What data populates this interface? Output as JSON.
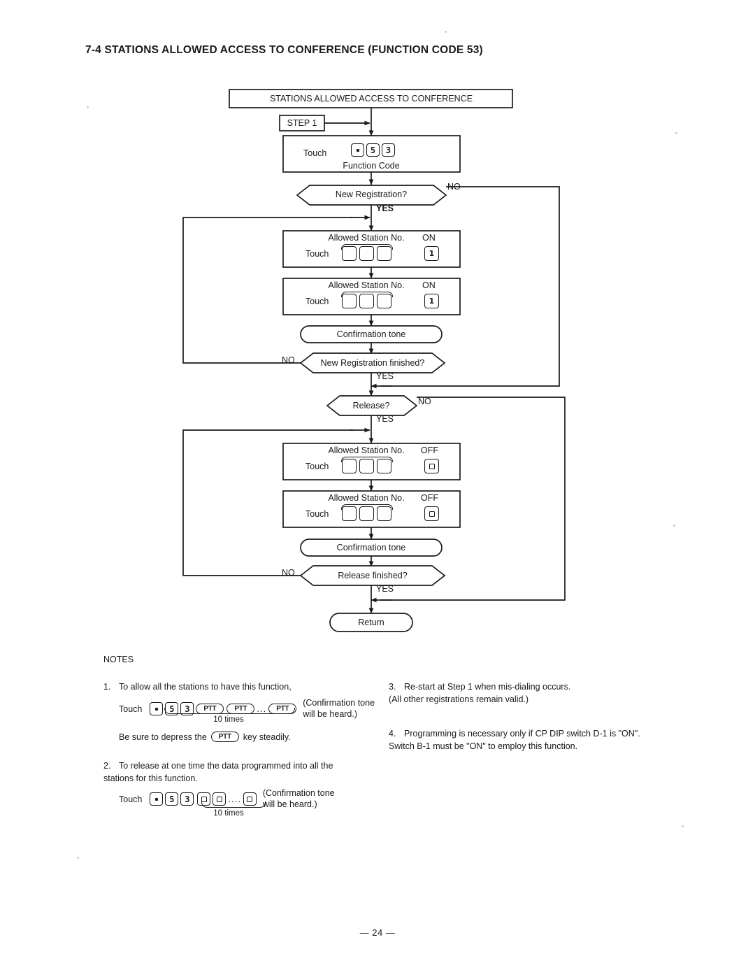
{
  "document": {
    "heading": "7-4 STATIONS ALLOWED ACCESS TO CONFERENCE (FUNCTION CODE 53)",
    "page_number": "— 24 —"
  },
  "flowchart": {
    "title_box": "STATIONS ALLOWED ACCESS TO CONFERENCE",
    "step_tag": "STEP 1",
    "function_code_box": {
      "touch_label": "Touch",
      "caption": "Function Code",
      "keys": [
        "dot",
        "5",
        "3"
      ]
    },
    "decisions": {
      "new_registration": "New Registration?",
      "new_registration_finished": "New Registration finished?",
      "release": "Release?",
      "release_finished": "Release finished?"
    },
    "branch_labels": {
      "yes": "YES",
      "no": "NO"
    },
    "station_on_box": {
      "title": "Allowed Station No.",
      "touch_label": "Touch",
      "state_label": "ON",
      "state_key": "1",
      "station_keys": [
        "",
        "",
        ""
      ]
    },
    "station_off_box": {
      "title": "Allowed Station No.",
      "touch_label": "Touch",
      "state_label": "OFF",
      "state_key": "0",
      "station_keys": [
        "",
        "",
        ""
      ]
    },
    "confirmation_tone": "Confirmation tone",
    "return_terminal": "Return"
  },
  "notes": {
    "label": "NOTES",
    "items": [
      {
        "number": "1.",
        "text": "To allow all the stations to have this function,",
        "touch_label": "Touch",
        "keys": [
          "dot",
          "5",
          "3"
        ],
        "ptt_label": "PTT",
        "ellipsis": "...",
        "repeat_label": "10 times",
        "paren_text": "(Confirmation tone\nwill be heard.)",
        "footer_before": "Be sure to depress the",
        "footer_after": "key steadily."
      },
      {
        "number": "2.",
        "text": "To release at one time the data programmed into all the\nstations for this function.",
        "touch_label": "Touch",
        "keys": [
          "dot",
          "5",
          "3"
        ],
        "zero_key": "0",
        "ellipsis": "....",
        "repeat_label": "10 times",
        "paren_text": "(Confirmation tone\nwill be heard.)"
      },
      {
        "number": "3.",
        "text": "Re-start at Step 1 when mis-dialing occurs.\n(All other registrations remain valid.)"
      },
      {
        "number": "4.",
        "text": "Programming is necessary only if CP DIP switch D-1 is \"ON\".\nSwitch B-1 must be \"ON\" to employ this function."
      }
    ]
  }
}
